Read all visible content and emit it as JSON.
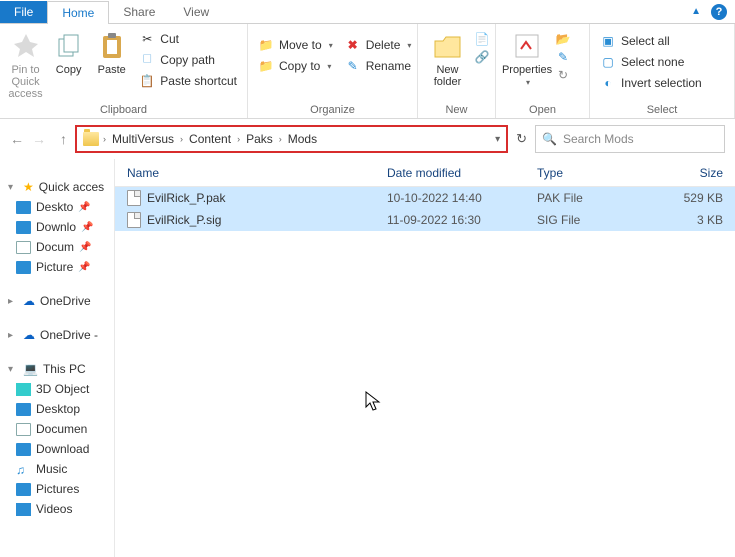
{
  "tabs": {
    "file": "File",
    "home": "Home",
    "share": "Share",
    "view": "View"
  },
  "ribbon": {
    "clipboard": {
      "label": "Clipboard",
      "pin": "Pin to Quick access",
      "copy": "Copy",
      "paste": "Paste",
      "cut": "Cut",
      "copypath": "Copy path",
      "pasteshortcut": "Paste shortcut"
    },
    "organize": {
      "label": "Organize",
      "moveto": "Move to",
      "copyto": "Copy to",
      "delete": "Delete",
      "rename": "Rename"
    },
    "new": {
      "label": "New",
      "newfolder": "New folder"
    },
    "open": {
      "label": "Open",
      "properties": "Properties"
    },
    "select": {
      "label": "Select",
      "all": "Select all",
      "none": "Select none",
      "invert": "Invert selection"
    }
  },
  "breadcrumb": [
    "MultiVersus",
    "Content",
    "Paks",
    "Mods"
  ],
  "search": {
    "placeholder": "Search Mods"
  },
  "tree": {
    "quick": "Quick acces",
    "quick_items": [
      "Deskto",
      "Downlo",
      "Docum",
      "Picture"
    ],
    "onedrive1": "OneDrive",
    "onedrive2": "OneDrive -",
    "thispc": "This PC",
    "pc_items": [
      "3D Object",
      "Desktop",
      "Documen",
      "Download",
      "Music",
      "Pictures",
      "Videos"
    ]
  },
  "columns": {
    "name": "Name",
    "date": "Date modified",
    "type": "Type",
    "size": "Size"
  },
  "files": [
    {
      "name": "EvilRick_P.pak",
      "date": "10-10-2022 14:40",
      "type": "PAK File",
      "size": "529 KB"
    },
    {
      "name": "EvilRick_P.sig",
      "date": "11-09-2022 16:30",
      "type": "SIG File",
      "size": "3 KB"
    }
  ]
}
